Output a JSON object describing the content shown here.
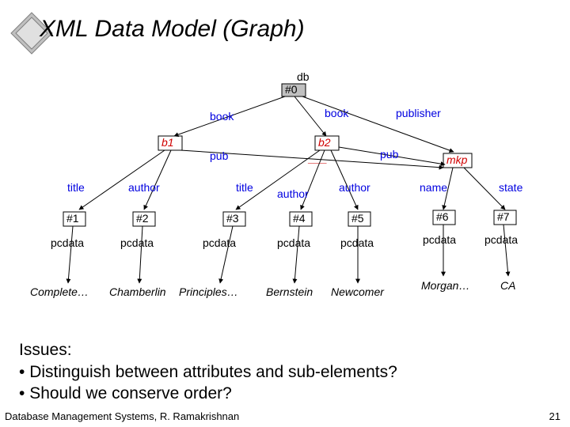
{
  "title": "XML Data Model (Graph)",
  "nodes": {
    "db": "db",
    "root_id": "#0",
    "b1": "b1",
    "b2": "b2",
    "mkp": "mkp",
    "n1": "#1",
    "n2": "#2",
    "n3": "#3",
    "n4": "#4",
    "n5": "#5",
    "n6": "#6",
    "n7": "#7"
  },
  "edges": {
    "book1": "book",
    "book2": "book",
    "publisher": "publisher",
    "pub_b1": "pub",
    "pub_b2": "pub",
    "title1": "title",
    "author1": "author",
    "title2": "title",
    "author2a": "author",
    "author2b": "author",
    "name": "name",
    "state": "state"
  },
  "pcdata": "pcdata",
  "leaves": {
    "l1": "Complete…",
    "l2": "Chamberlin",
    "l3": "Principles…",
    "l4": "Bernstein",
    "l5": "Newcomer",
    "l6": "Morgan…",
    "l7": "CA"
  },
  "issues": {
    "heading": "Issues:",
    "b1": "Distinguish between attributes and sub-elements?",
    "b2": "Should we conserve order?"
  },
  "footer": "Database Management Systems, R. Ramakrishnan",
  "page": "21"
}
